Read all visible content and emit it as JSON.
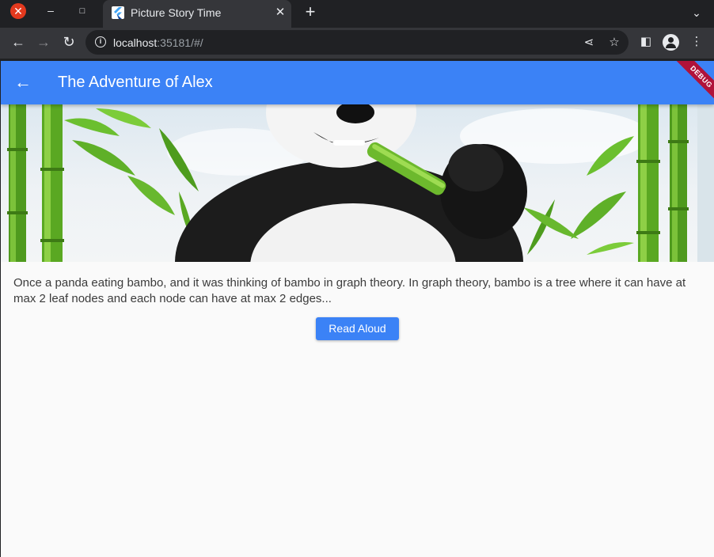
{
  "browser": {
    "tab_title": "Picture Story Time",
    "url_host": "localhost",
    "url_rest": ":35181/#/"
  },
  "app": {
    "title": "The Adventure of Alex",
    "debug_banner": "DEBUG",
    "accent_color": "#3b82f6"
  },
  "story": {
    "text": "Once a panda eating bambo, and it was thinking of bambo in graph theory. In graph theory, bambo is a tree where it can have at max 2 leaf nodes and each node can have at max 2 edges...",
    "read_button_label": "Read Aloud"
  },
  "icons": {
    "window_close": "close-icon",
    "window_minimize": "minimize-icon",
    "window_maximize": "maximize-icon",
    "tab_close": "close-icon",
    "new_tab": "plus-icon",
    "back": "arrow-left-icon",
    "forward": "arrow-right-icon",
    "reload": "reload-icon",
    "site_info": "info-icon",
    "share": "share-icon",
    "bookmark": "star-icon",
    "side_panel": "side-panel-icon",
    "profile": "avatar-icon",
    "menu": "kebab-menu-icon",
    "app_back": "arrow-left-icon"
  }
}
